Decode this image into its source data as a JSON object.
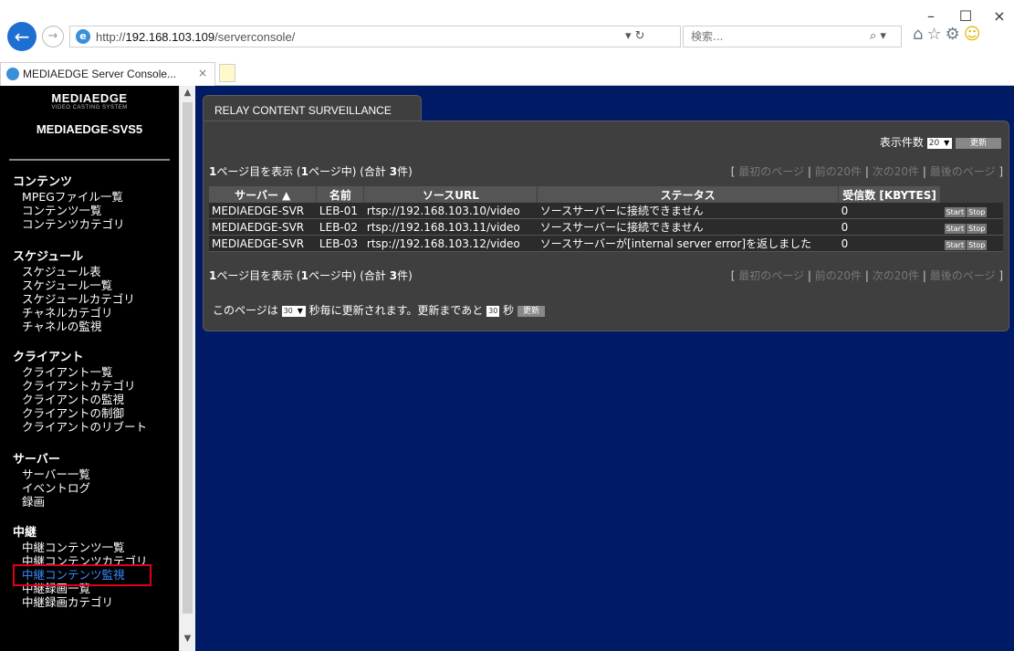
{
  "browser": {
    "url_base": "http://",
    "url_host": "192.168.103.109",
    "url_path": "/serverconsole/",
    "search_placeholder": "検索...",
    "tab_title": "MEDIAEDGE Server Console...",
    "window_controls": {
      "minimize": "–",
      "maximize": "☐",
      "close": "×"
    }
  },
  "sidebar": {
    "logo": "MEDIAEDGE",
    "logo_sub": "VIDEO CASTING SYSTEM",
    "server_name": "MEDIAEDGE-SVS5",
    "groups": [
      {
        "title": "コンテンツ",
        "items": [
          "MPEGファイル一覧",
          "コンテンツ一覧",
          "コンテンツカテゴリ"
        ]
      },
      {
        "title": "スケジュール",
        "items": [
          "スケジュール表",
          "スケジュール一覧",
          "スケジュールカテゴリ",
          "チャネルカテゴリ",
          "チャネルの監視"
        ]
      },
      {
        "title": "クライアント",
        "items": [
          "クライアント一覧",
          "クライアントカテゴリ",
          "クライアントの監視",
          "クライアントの制御",
          "クライアントのリブート"
        ]
      },
      {
        "title": "サーバー",
        "items": [
          "サーバー一覧",
          "イベントログ",
          "録画"
        ]
      },
      {
        "title": "中継",
        "items": [
          "中継コンテンツ一覧",
          "中継コンテンツカテゴリ",
          "中継コンテンツ監視",
          "中継録画一覧",
          "中継録画カテゴリ"
        ]
      }
    ],
    "active_item": "中継コンテンツ監視"
  },
  "panel": {
    "title": "RELAY CONTENT SURVEILLANCE",
    "count_label": "表示件数",
    "count_value": "20",
    "update_label": "更新",
    "page_info_prefix": "1",
    "page_info_mid": "ページ目を表示 (",
    "page_info_total_pages": "1",
    "page_info_suffix": "ページ中) (合計",
    "page_info_count": "3",
    "page_info_unit": "件)",
    "pager": {
      "first": "最初のページ",
      "prev": "前の20件",
      "next": "次の20件",
      "last": "最後のページ"
    },
    "table": {
      "columns": [
        "サーバー ▲",
        "名前",
        "ソースURL",
        "ステータス",
        "受信数 [KBYTES]",
        ""
      ],
      "rows": [
        {
          "server": "MEDIAEDGE-SVR",
          "name": "LEB-01",
          "url": "rtsp://192.168.103.10/video",
          "status": "ソースサーバーに接続できません",
          "received": "0"
        },
        {
          "server": "MEDIAEDGE-SVR",
          "name": "LEB-02",
          "url": "rtsp://192.168.103.11/video",
          "status": "ソースサーバーに接続できません",
          "received": "0"
        },
        {
          "server": "MEDIAEDGE-SVR",
          "name": "LEB-03",
          "url": "rtsp://192.168.103.12/video",
          "status": "ソースサーバーが[internal server error]を返しました",
          "received": "0"
        }
      ],
      "start_label": "Start",
      "stop_label": "Stop"
    },
    "refresh_prefix": "このページは",
    "refresh_interval": "30",
    "refresh_mid": "秒毎に更新されます。更新まであと",
    "refresh_remaining": "30",
    "refresh_suffix": "秒",
    "refresh_button": "更新"
  },
  "colors": {
    "main_bg": "#001a66",
    "sidebar_bg": "#000000",
    "panel_bg": "#3f3f3f",
    "active_link": "#3d8cff",
    "highlight_border": "#e0001a"
  }
}
